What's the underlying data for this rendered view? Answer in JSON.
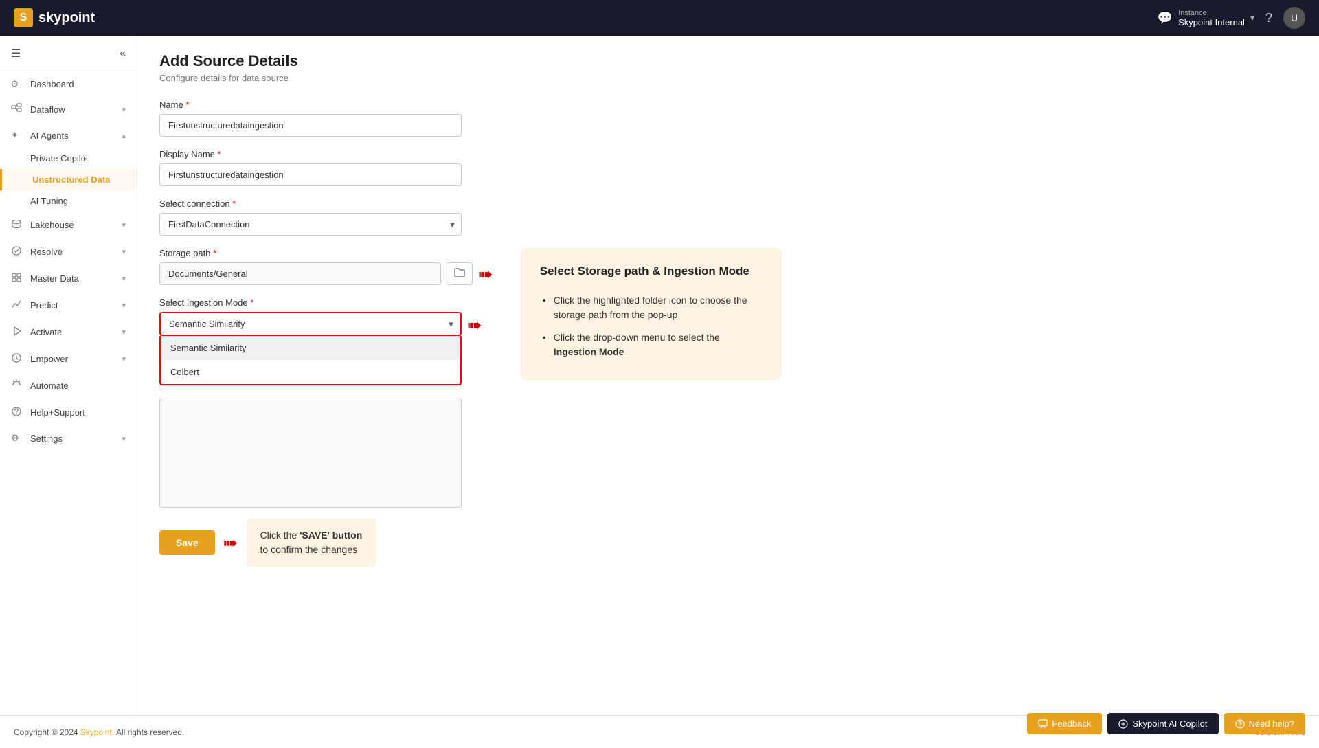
{
  "topbar": {
    "logo_letter": "S",
    "logo_name": "skypoint",
    "instance_label": "Instance",
    "instance_name": "Skypoint Internal",
    "help_icon": "?",
    "avatar_text": "U"
  },
  "sidebar": {
    "menu_icon": "☰",
    "collapse_icon": "«",
    "items": [
      {
        "id": "dashboard",
        "label": "Dashboard",
        "icon": "⊙",
        "has_sub": false
      },
      {
        "id": "dataflow",
        "label": "Dataflow",
        "icon": "⬡",
        "has_sub": true
      },
      {
        "id": "ai-agents",
        "label": "AI Agents",
        "icon": "✦",
        "has_sub": true,
        "expanded": true
      },
      {
        "id": "private-copilot",
        "label": "Private Copilot",
        "is_sub": true
      },
      {
        "id": "unstructured-data",
        "label": "Unstructured Data",
        "is_sub": true,
        "active": true
      },
      {
        "id": "ai-tuning",
        "label": "AI Tuning",
        "is_sub": true
      },
      {
        "id": "lakehouse",
        "label": "Lakehouse",
        "icon": "⬡",
        "has_sub": true
      },
      {
        "id": "resolve",
        "label": "Resolve",
        "icon": "⬡",
        "has_sub": true
      },
      {
        "id": "master-data",
        "label": "Master Data",
        "icon": "⬡",
        "has_sub": true
      },
      {
        "id": "predict",
        "label": "Predict",
        "icon": "⬡",
        "has_sub": true
      },
      {
        "id": "activate",
        "label": "Activate",
        "icon": "⬡",
        "has_sub": true
      },
      {
        "id": "empower",
        "label": "Empower",
        "icon": "⬡",
        "has_sub": true
      },
      {
        "id": "automate",
        "label": "Automate",
        "icon": "⬡",
        "has_sub": false
      },
      {
        "id": "help-support",
        "label": "Help+Support",
        "icon": "⬡",
        "has_sub": false
      },
      {
        "id": "settings",
        "label": "Settings",
        "icon": "⚙",
        "has_sub": true
      }
    ]
  },
  "page": {
    "title": "Add Source Details",
    "subtitle": "Configure details for data source",
    "name_label": "Name",
    "name_value": "Firstunstructuredataingestion",
    "display_name_label": "Display Name",
    "display_name_value": "Firstunstructuredataingestion",
    "connection_label": "Select connection",
    "connection_value": "FirstDataConnection",
    "storage_path_label": "Storage path",
    "storage_path_value": "Documents/General",
    "ingestion_mode_label": "Select Ingestion Mode",
    "ingestion_mode_value": "Semantic Similarity",
    "dropdown_options": [
      {
        "value": "semantic-similarity",
        "label": "Semantic Similarity",
        "selected": true
      },
      {
        "value": "colbert",
        "label": "Colbert",
        "selected": false
      }
    ]
  },
  "hint_box": {
    "title": "Select Storage path & Ingestion Mode",
    "bullet1": "Click the highlighted folder icon to choose the storage path from the pop-up",
    "bullet2_prefix": "Click the drop-down menu to select the ",
    "bullet2_bold": "Ingestion Mode"
  },
  "save_area": {
    "save_label": "Save",
    "tooltip_text_prefix": "Click the ",
    "tooltip_bold": "'SAVE' button",
    "tooltip_text_suffix": " to confirm the changes"
  },
  "bottom_bar": {
    "copyright": "Copyright © 2024",
    "brand_link": "Skypoint.",
    "rights": " All rights reserved.",
    "version": "Version: 7.4.6"
  },
  "action_buttons": {
    "feedback": "Feedback",
    "copilot": "Skypoint AI Copilot",
    "needhelp": "Need help?"
  }
}
